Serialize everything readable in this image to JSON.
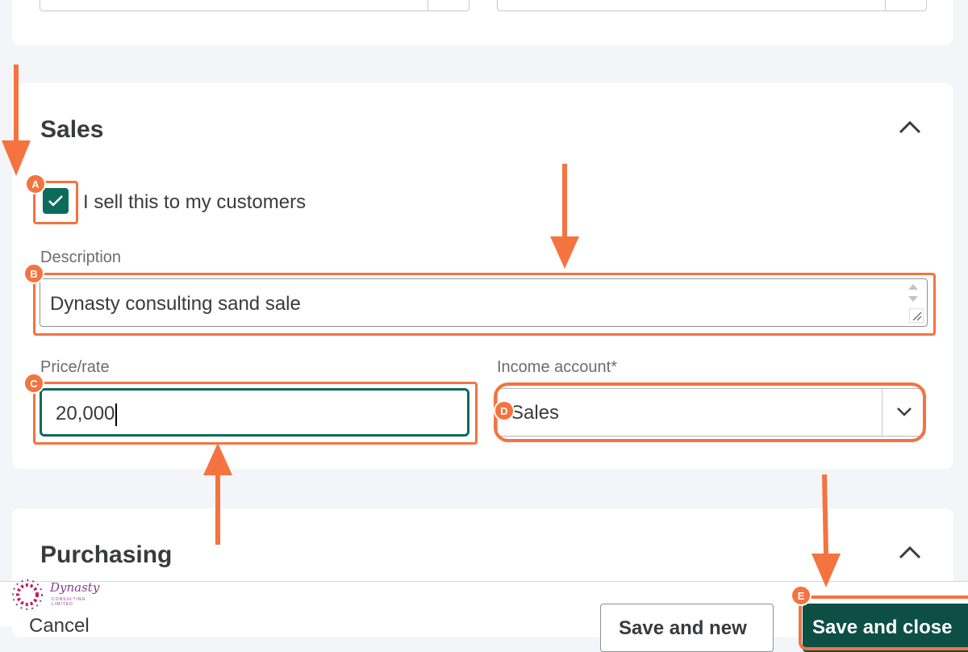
{
  "sales": {
    "title": "Sales",
    "sell_checkbox_label": "I sell this to my customers",
    "description_label": "Description",
    "description_value": "Dynasty consulting sand sale",
    "price_label": "Price/rate",
    "price_value": "20,000",
    "income_label": "Income account*",
    "income_value": "Sales"
  },
  "purchasing": {
    "title": "Purchasing"
  },
  "footer": {
    "cancel_label": "Cancel",
    "save_new_label": "Save and new",
    "save_close_label": "Save and close"
  },
  "annotations": {
    "a": "A",
    "b": "B",
    "c": "C",
    "d": "D",
    "e": "E"
  },
  "logo": {
    "name": "Dynasty",
    "sub": "CONSULTING LIMITED"
  },
  "colors": {
    "accent_green": "#0d6b5c",
    "callout_orange": "#f4733f",
    "primary_dark": "#0d4f45"
  }
}
